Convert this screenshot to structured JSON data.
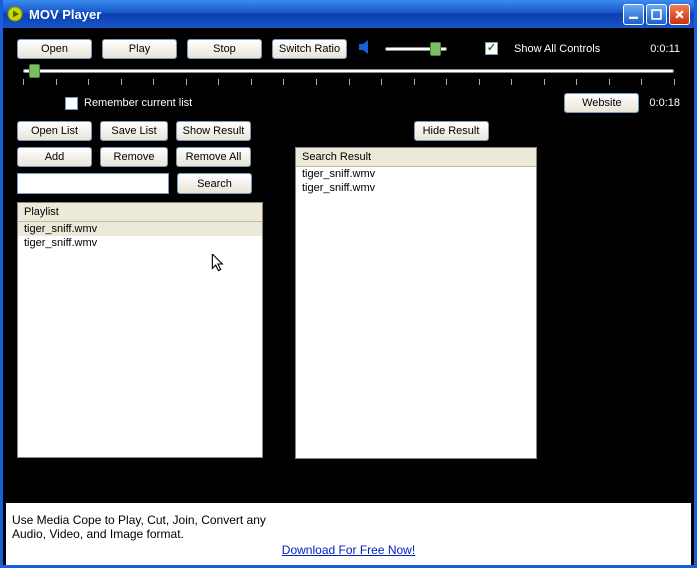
{
  "title": "MOV Player",
  "top_buttons": {
    "open": "Open",
    "play": "Play",
    "stop": "Stop",
    "switch_ratio": "Switch Ratio"
  },
  "show_all_controls": {
    "label": "Show All Controls",
    "checked": true
  },
  "time_elapsed": "0:0:11",
  "time_total": "0:0:18",
  "remember": {
    "label": "Remember current list",
    "checked": false
  },
  "website_btn": "Website",
  "left_buttons": {
    "open_list": "Open List",
    "save_list": "Save List",
    "show_result": "Show Result",
    "add": "Add",
    "remove": "Remove",
    "remove_all": "Remove All",
    "search": "Search"
  },
  "search_value": "",
  "playlist": {
    "header": "Playlist",
    "items": [
      {
        "name": "tiger_sniff.wmv",
        "selected": true
      },
      {
        "name": "tiger_sniff.wmv",
        "selected": false
      }
    ]
  },
  "hide_result_btn": "Hide Result",
  "search_result": {
    "header": "Search Result",
    "items": [
      {
        "name": "tiger_sniff.wmv"
      },
      {
        "name": "tiger_sniff.wmv"
      }
    ]
  },
  "footer": {
    "line1": "Use Media Cope to Play, Cut, Join, Convert any",
    "line2": "Audio, Video, and Image format.",
    "link": "Download For Free Now!"
  },
  "volume_position_pct": 88,
  "seek_position_pct": 1
}
